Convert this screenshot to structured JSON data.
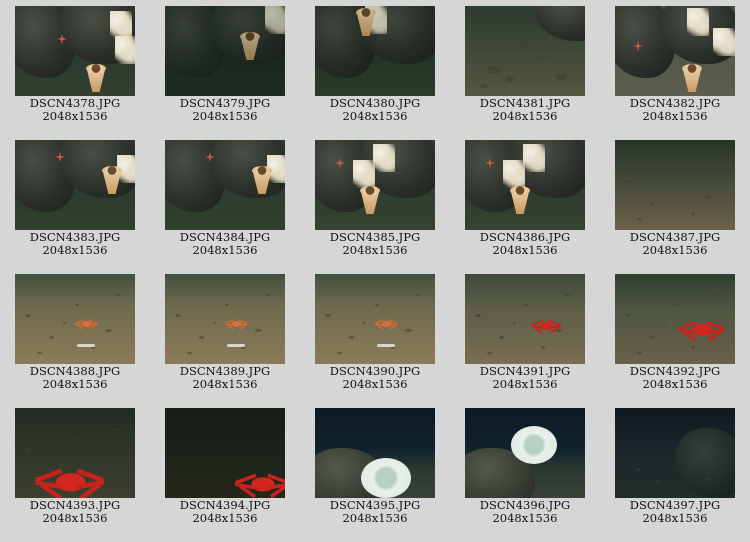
{
  "page": {
    "background": "#d6d6d6",
    "columns": 5
  },
  "thumbnails": [
    {
      "filename": "DSCN4378.JPG",
      "dimensions": "2048x1536",
      "scene": "reef-sponge",
      "icon": "thumbnail-image"
    },
    {
      "filename": "DSCN4379.JPG",
      "dimensions": "2048x1536",
      "scene": "reef-sponge-dark",
      "icon": "thumbnail-image"
    },
    {
      "filename": "DSCN4380.JPG",
      "dimensions": "2048x1536",
      "scene": "reef-sponge-top",
      "icon": "thumbnail-image"
    },
    {
      "filename": "DSCN4381.JPG",
      "dimensions": "2048x1536",
      "scene": "seafloor-rocky",
      "icon": "thumbnail-image"
    },
    {
      "filename": "DSCN4382.JPG",
      "dimensions": "2048x1536",
      "scene": "reef-sponge-bright",
      "icon": "thumbnail-image"
    },
    {
      "filename": "DSCN4383.JPG",
      "dimensions": "2048x1536",
      "scene": "reef-sponge-low",
      "icon": "thumbnail-image"
    },
    {
      "filename": "DSCN4384.JPG",
      "dimensions": "2048x1536",
      "scene": "reef-sponge-low",
      "icon": "thumbnail-image"
    },
    {
      "filename": "DSCN4385.JPG",
      "dimensions": "2048x1536",
      "scene": "reef-sponge-coral",
      "icon": "thumbnail-image"
    },
    {
      "filename": "DSCN4386.JPG",
      "dimensions": "2048x1536",
      "scene": "reef-sponge-coral",
      "icon": "thumbnail-image"
    },
    {
      "filename": "DSCN4387.JPG",
      "dimensions": "2048x1536",
      "scene": "sand-plain",
      "icon": "thumbnail-image"
    },
    {
      "filename": "DSCN4388.JPG",
      "dimensions": "2048x1536",
      "scene": "sand-orange-crab",
      "icon": "thumbnail-image"
    },
    {
      "filename": "DSCN4389.JPG",
      "dimensions": "2048x1536",
      "scene": "sand-orange-crab",
      "icon": "thumbnail-image"
    },
    {
      "filename": "DSCN4390.JPG",
      "dimensions": "2048x1536",
      "scene": "sand-orange-crab",
      "icon": "thumbnail-image"
    },
    {
      "filename": "DSCN4391.JPG",
      "dimensions": "2048x1536",
      "scene": "sand-red-crab",
      "icon": "thumbnail-image"
    },
    {
      "filename": "DSCN4392.JPG",
      "dimensions": "2048x1536",
      "scene": "sand-red-crab-large",
      "icon": "thumbnail-image"
    },
    {
      "filename": "DSCN4393.JPG",
      "dimensions": "2048x1536",
      "scene": "dark-red-crab",
      "icon": "thumbnail-image"
    },
    {
      "filename": "DSCN4394.JPG",
      "dimensions": "2048x1536",
      "scene": "dark-red-crab-corner",
      "icon": "thumbnail-image"
    },
    {
      "filename": "DSCN4395.JPG",
      "dimensions": "2048x1536",
      "scene": "dark-anemone-low",
      "icon": "thumbnail-image"
    },
    {
      "filename": "DSCN4396.JPG",
      "dimensions": "2048x1536",
      "scene": "dark-anemone-mid",
      "icon": "thumbnail-image"
    },
    {
      "filename": "DSCN4397.JPG",
      "dimensions": "2048x1536",
      "scene": "dark-seafloor",
      "icon": "thumbnail-image"
    }
  ]
}
